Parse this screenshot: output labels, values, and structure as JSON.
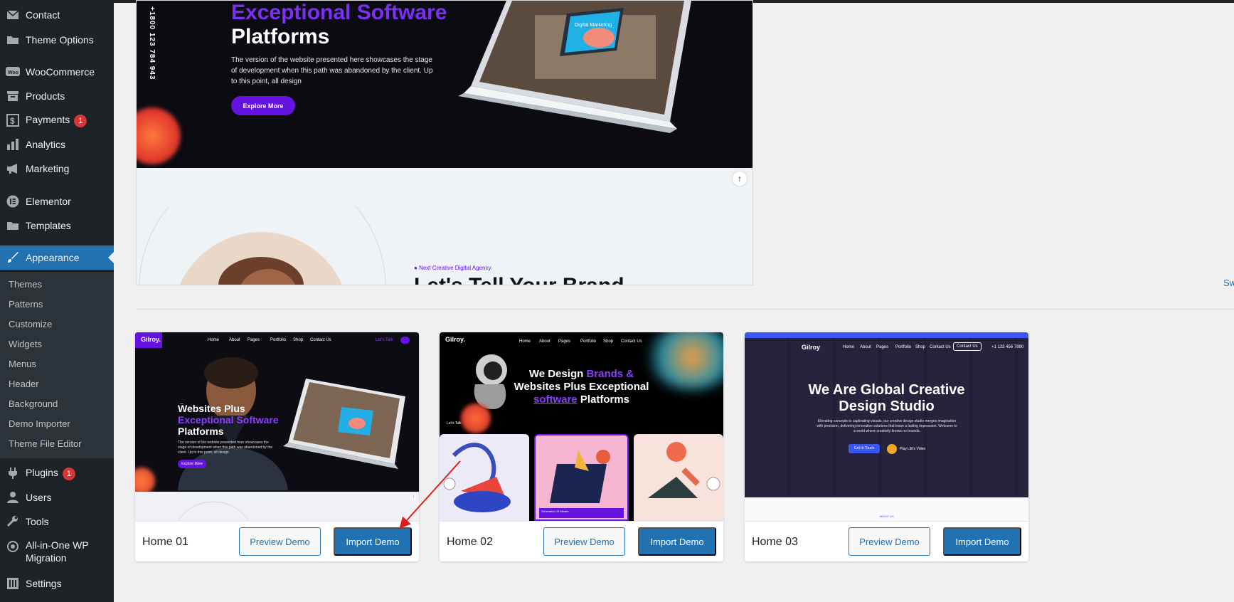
{
  "sidebar": {
    "items": [
      {
        "label": "Contact",
        "icon": "mail-icon"
      },
      {
        "label": "Theme Options",
        "icon": "folder-icon"
      },
      {
        "label": "WooCommerce",
        "icon": "woo-icon"
      },
      {
        "label": "Products",
        "icon": "archive-icon"
      },
      {
        "label": "Payments",
        "icon": "dollar-icon",
        "badge": "1"
      },
      {
        "label": "Analytics",
        "icon": "bar-chart-icon"
      },
      {
        "label": "Marketing",
        "icon": "megaphone-icon"
      },
      {
        "label": "Elementor",
        "icon": "elementor-icon"
      },
      {
        "label": "Templates",
        "icon": "folder-icon"
      },
      {
        "label": "Appearance",
        "icon": "brush-icon",
        "active": true
      },
      {
        "label": "Plugins",
        "icon": "plug-icon",
        "badge": "1"
      },
      {
        "label": "Users",
        "icon": "user-icon"
      },
      {
        "label": "Tools",
        "icon": "wrench-icon"
      },
      {
        "label": "All-in-One WP",
        "label2": "Migration",
        "icon": "migration-icon"
      },
      {
        "label": "Settings",
        "icon": "settings-icon"
      }
    ],
    "submenu": [
      "Themes",
      "Patterns",
      "Customize",
      "Widgets",
      "Menus",
      "Header",
      "Background",
      "Demo Importer",
      "Theme File Editor"
    ]
  },
  "preview": {
    "phone": "+1800 123 784 943",
    "title_line1": "Exceptional Software",
    "title_line2": "Platforms",
    "description": "The version of the website presented here showcases the stage of development when this path was abandoned by the client. Up to this point, all design",
    "button": "Explore More",
    "laptop_screen_text": "Digital Marketing",
    "agency_tag": "Next Creative Digital Agency.",
    "brand_title": "Let's Tell Your Brand"
  },
  "side_link": "Sw",
  "demos": [
    {
      "name": "Home 01",
      "preview_label": "Preview Demo",
      "import_label": "Import Demo",
      "thumb": {
        "logo": "Gilroy.",
        "nav": [
          "Home",
          "About",
          "Pages",
          "Portfolio",
          "Shop",
          "Contact Us"
        ],
        "cta": "Let's Talk",
        "line1": "Websites Plus",
        "line2": "Exceptional Software",
        "line3": "Platforms",
        "desc": "The version of the website presented here showcases the stage of development when this path was abandoned by the client. Up to this point, all design",
        "button": "Explore More"
      }
    },
    {
      "name": "Home 02",
      "preview_label": "Preview Demo",
      "import_label": "Import Demo",
      "thumb": {
        "logo": "Gilroy.",
        "nav": [
          "Home",
          "About",
          "Pages",
          "Portfolio",
          "Shop",
          "Contact Us"
        ],
        "line1a": "We Design ",
        "line1b": "Brands &",
        "line2": "Websites Plus Exceptional",
        "line3a": "software",
        "line3b": " Platforms",
        "talk": "Let's Talk",
        "caption": "Generation Of Wealth"
      }
    },
    {
      "name": "Home 03",
      "preview_label": "Preview Demo",
      "import_label": "Import Demo",
      "thumb": {
        "logo": "Gilroy",
        "nav": [
          "Home",
          "About",
          "Pages",
          "Portfolio",
          "Shop",
          "Contact Us"
        ],
        "contact_btn": "Contact Us",
        "phone": "+1 123 456 7890",
        "title1": "We Are Global Creative",
        "title2": "Design Studio",
        "desc": "Elevating concepts to captivating visuals, our creative design studio merges imagination with precision, delivering innovative solutions that leave a lasting impression. Welcome to a world where creativity knows no bounds.",
        "btn1": "Get In Touch",
        "btn2": "Play Lilit's Video",
        "about": "ABOUT US"
      }
    }
  ]
}
